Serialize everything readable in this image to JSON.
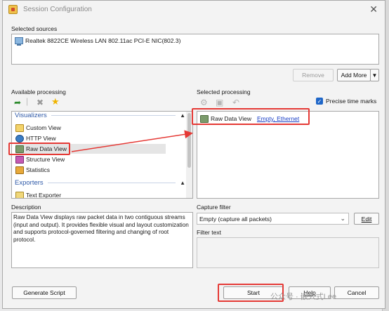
{
  "window": {
    "title": "Session Configuration"
  },
  "sources": {
    "label": "Selected sources",
    "item": "Realtek 8822CE Wireless LAN 802.11ac PCI-E NIC(802.3)",
    "remove_label": "Remove",
    "add_more_label": "Add More"
  },
  "available": {
    "label": "Available processing",
    "groups": {
      "visualizers": "Visualizers",
      "exporters": "Exporters"
    },
    "items": [
      "Custom View",
      "HTTP View",
      "Raw Data View",
      "Structure View",
      "Statistics"
    ],
    "exporter_items": [
      "Text Exporter"
    ]
  },
  "selected": {
    "label": "Selected processing",
    "precise_label": "Precise time marks",
    "item_name": "Raw Data View",
    "item_link": "Empty, Ethernet"
  },
  "description": {
    "label": "Description",
    "text": "Raw Data View displays raw packet data in two contiguous streams (input and output). It provides flexible visual and layout customization and supports protocol-governed filtering and changing of root protocol."
  },
  "capture": {
    "label": "Capture filter",
    "value": "Empty (capture all packets)",
    "edit_label": "Edit",
    "filter_text_label": "Filter text"
  },
  "footer": {
    "generate_label": "Generate Script",
    "start_label": "Start",
    "help_label": "Help",
    "cancel_label": "Cancel"
  },
  "watermark": "公众号 · 嵌入式Lee",
  "colors": {
    "annotation": "#e53935",
    "accent": "#1e66c8",
    "group_header": "#2f5aa8"
  }
}
